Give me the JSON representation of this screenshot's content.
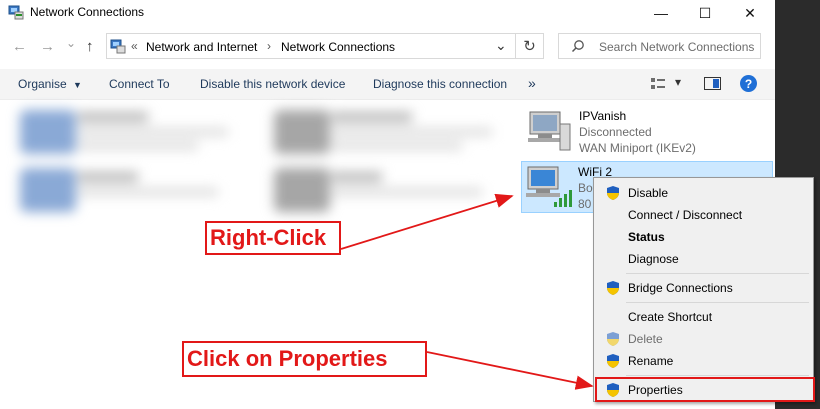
{
  "window": {
    "title": "Network Connections",
    "minimize_glyph": "—",
    "maximize_glyph": "☐",
    "close_glyph": "✕"
  },
  "nav": {
    "back_glyph": "←",
    "forward_glyph": "→",
    "recent_glyph": "⌄",
    "up_glyph": "↑",
    "breadcrumb_prefix": "«",
    "breadcrumb": [
      "Network and Internet",
      "Network Connections"
    ],
    "breadcrumb_sep": "›",
    "dropdown_glyph": "⌄",
    "refresh_glyph": "↻",
    "search_placeholder": "Search Network Connections"
  },
  "commandbar": {
    "organise": "Organise",
    "connect_to": "Connect To",
    "disable_device": "Disable this network device",
    "diagnose": "Diagnose this connection",
    "more": "»",
    "view_glyph": "▾",
    "help": "?"
  },
  "adapters": [
    {
      "name": "IPVanish",
      "status": "Disconnected",
      "device": "WAN Miniport (IKEv2)"
    },
    {
      "name": "WiFi 2",
      "status": "Bo",
      "device": "80"
    }
  ],
  "context_menu": {
    "items": [
      {
        "label": "Disable",
        "shield": true,
        "bold": false,
        "disabled": false
      },
      {
        "label": "Connect / Disconnect",
        "shield": false,
        "bold": false,
        "disabled": false
      },
      {
        "label": "Status",
        "shield": false,
        "bold": true,
        "disabled": false
      },
      {
        "label": "Diagnose",
        "shield": false,
        "bold": false,
        "disabled": false
      },
      {
        "label": "Bridge Connections",
        "shield": true,
        "bold": false,
        "disabled": false
      },
      {
        "label": "Create Shortcut",
        "shield": false,
        "bold": false,
        "disabled": false
      },
      {
        "label": "Delete",
        "shield": true,
        "bold": false,
        "disabled": true
      },
      {
        "label": "Rename",
        "shield": true,
        "bold": false,
        "disabled": false
      },
      {
        "label": "Properties",
        "shield": true,
        "bold": false,
        "disabled": false
      }
    ]
  },
  "annotations": {
    "right_click": "Right-Click",
    "click_properties": "Click on Properties"
  },
  "colors": {
    "annotation_red": "#e21818",
    "selection_blue": "#cce8ff",
    "shield_blue": "#1f5fbf",
    "shield_yellow": "#f5c400"
  }
}
